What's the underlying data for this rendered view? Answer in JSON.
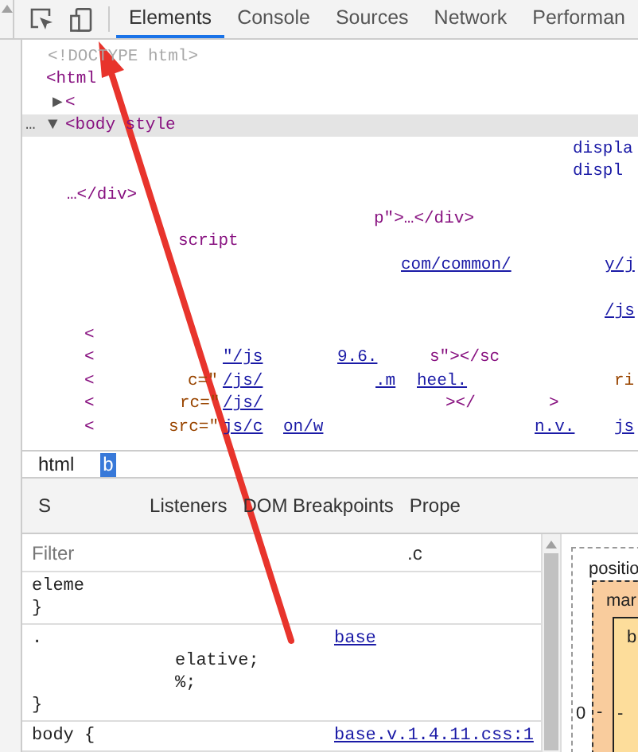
{
  "toolbar": {
    "tabs": [
      {
        "label": "Elements",
        "selected": true
      },
      {
        "label": "Console",
        "selected": false
      },
      {
        "label": "Sources",
        "selected": false
      },
      {
        "label": "Network",
        "selected": false
      },
      {
        "label": "Performan",
        "selected": false
      }
    ]
  },
  "dom_tree": {
    "lines": [
      {
        "selected": false,
        "segments": [
          {
            "text": "<!DOCTYPE html>",
            "kind": "doctype"
          }
        ]
      },
      {
        "selected": false,
        "segments": [
          {
            "text": "<html",
            "kind": "tag"
          }
        ]
      },
      {
        "selected": false,
        "segments": [
          {
            "text": "▶",
            "kind": "marker"
          },
          {
            "text": "<",
            "kind": "tag"
          }
        ]
      },
      {
        "selected": true,
        "segments": [
          {
            "text": "…",
            "kind": "marker"
          },
          {
            "text": "▼",
            "kind": "marker"
          },
          {
            "text": "<body style",
            "kind": "tag"
          }
        ]
      },
      {
        "selected": false,
        "segments": [
          {
            "text": "displa",
            "kind": "value"
          }
        ]
      },
      {
        "selected": false,
        "segments": [
          {
            "text": "displ",
            "kind": "value"
          }
        ]
      },
      {
        "selected": false,
        "segments": [
          {
            "text": "…</div>",
            "kind": "tag"
          }
        ]
      },
      {
        "selected": false,
        "segments": [
          {
            "text": "p\">…</div>",
            "kind": "tag"
          }
        ]
      },
      {
        "selected": false,
        "segments": [
          {
            "text": "script",
            "kind": "tag"
          }
        ]
      },
      {
        "selected": false,
        "segments": [
          {
            "text": "com/common/",
            "kind": "link"
          },
          {
            "text": "y/j",
            "kind": "link"
          }
        ]
      },
      {
        "selected": false,
        "segments": [
          {
            "text": "/js",
            "kind": "link"
          }
        ]
      },
      {
        "selected": false,
        "segments": [
          {
            "text": "<",
            "kind": "tag"
          }
        ]
      },
      {
        "selected": false,
        "segments": [
          {
            "text": "<",
            "kind": "tag"
          },
          {
            "text": "\"/js",
            "kind": "link"
          },
          {
            "text": "9.6.",
            "kind": "link"
          },
          {
            "text": "s\"></sc",
            "kind": "tag"
          }
        ]
      },
      {
        "selected": false,
        "segments": [
          {
            "text": "<",
            "kind": "tag"
          },
          {
            "text": "c=\"",
            "kind": "attr"
          },
          {
            "text": "/js/",
            "kind": "link"
          },
          {
            "text": ".m",
            "kind": "link"
          },
          {
            "text": "heel.",
            "kind": "link"
          },
          {
            "text": "ri",
            "kind": "attr"
          }
        ]
      },
      {
        "selected": false,
        "segments": [
          {
            "text": "<",
            "kind": "tag"
          },
          {
            "text": "rc=\"",
            "kind": "attr"
          },
          {
            "text": "/js/",
            "kind": "link"
          },
          {
            "text": "></",
            "kind": "tag"
          },
          {
            "text": ">",
            "kind": "tag"
          }
        ]
      },
      {
        "selected": false,
        "segments": [
          {
            "text": "<",
            "kind": "tag"
          },
          {
            "text": "src=\"",
            "kind": "attr"
          },
          {
            "text": "js/c",
            "kind": "link"
          },
          {
            "text": "on/w",
            "kind": "link"
          },
          {
            "text": "n.v.",
            "kind": "link"
          },
          {
            "text": "js",
            "kind": "link"
          }
        ]
      }
    ]
  },
  "breadcrumbs": [
    {
      "label": "html",
      "selected": false
    },
    {
      "label": "b",
      "selected": true
    }
  ],
  "sidebar_tabs": [
    "S",
    "Listeners",
    "DOM Breakpoints",
    "Prope"
  ],
  "styles": {
    "filter": {
      "placeholder": "Filter"
    },
    "filter_button": ".c",
    "rules": [
      {
        "lines": [
          [
            {
              "text": "eleme",
              "kind": "selector"
            }
          ],
          [
            {
              "text": "}",
              "kind": "text"
            }
          ]
        ]
      },
      {
        "lines": [
          [
            {
              "text": ".",
              "kind": "selector"
            },
            {
              "text": "base",
              "kind": "link"
            }
          ],
          [
            {
              "text": "elative;",
              "kind": "text"
            }
          ],
          [
            {
              "text": "%;",
              "kind": "text"
            }
          ],
          [
            {
              "text": "}",
              "kind": "text"
            }
          ]
        ]
      },
      {
        "lines": [
          [
            {
              "text": "body {",
              "kind": "selector"
            },
            {
              "text": "base.v.1.4.11.css:1",
              "kind": "link"
            }
          ]
        ]
      }
    ]
  },
  "box_model": {
    "position_label": "positio",
    "margin_label": "mar",
    "border_label": "b",
    "position_value": "0",
    "margin_value": "-",
    "border_value": "-"
  }
}
